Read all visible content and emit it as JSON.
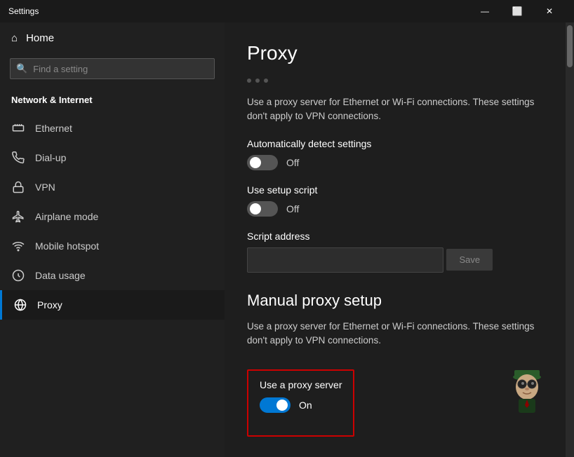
{
  "titlebar": {
    "title": "Settings",
    "minimize_label": "—",
    "maximize_label": "⬜",
    "close_label": "✕"
  },
  "sidebar": {
    "home_label": "Home",
    "search_placeholder": "Find a setting",
    "section_title": "Network & Internet",
    "items": [
      {
        "id": "ethernet",
        "label": "Ethernet",
        "icon": "🖥"
      },
      {
        "id": "dialup",
        "label": "Dial-up",
        "icon": "📞"
      },
      {
        "id": "vpn",
        "label": "VPN",
        "icon": "🔒"
      },
      {
        "id": "airplane",
        "label": "Airplane mode",
        "icon": "✈"
      },
      {
        "id": "hotspot",
        "label": "Mobile hotspot",
        "icon": "📡"
      },
      {
        "id": "datausage",
        "label": "Data usage",
        "icon": "⊙"
      },
      {
        "id": "proxy",
        "label": "Proxy",
        "icon": "🌐",
        "active": true
      }
    ]
  },
  "content": {
    "page_title": "Proxy",
    "auto_proxy_desc": "Use a proxy server for Ethernet or Wi-Fi connections. These settings don't apply to VPN connections.",
    "auto_detect_label": "Automatically detect settings",
    "auto_detect_status": "Off",
    "auto_detect_state": "off",
    "setup_script_label": "Use setup script",
    "setup_script_status": "Off",
    "setup_script_state": "off",
    "script_address_label": "Script address",
    "script_address_placeholder": "",
    "save_label": "Save",
    "manual_proxy_title": "Manual proxy setup",
    "manual_proxy_desc": "Use a proxy server for Ethernet or Wi-Fi connections. These settings don't apply to VPN connections.",
    "use_proxy_label": "Use a proxy server",
    "use_proxy_status": "On",
    "use_proxy_state": "on"
  }
}
